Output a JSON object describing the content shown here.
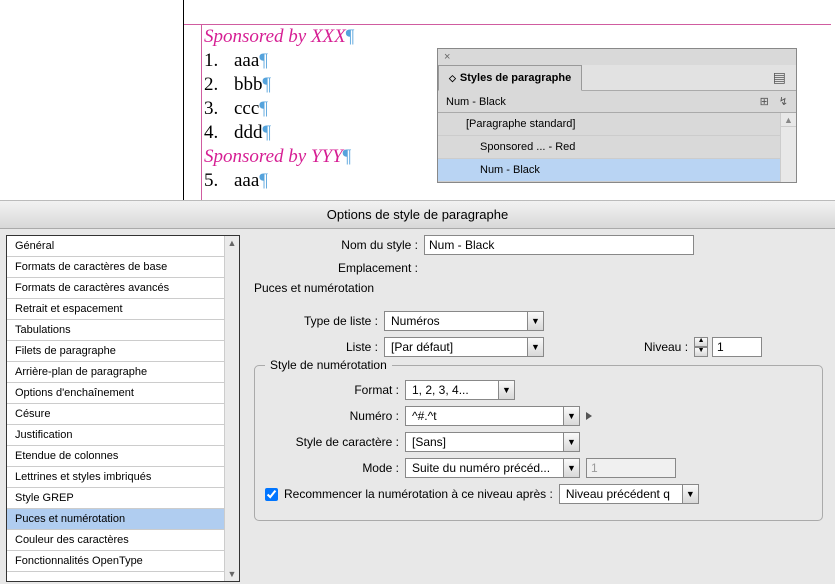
{
  "document": {
    "sponsored_x": "Sponsored by XXX",
    "sponsored_y": "Sponsored by YYY",
    "pilcrow": "¶",
    "items": [
      {
        "n": "1.",
        "t": "aaa"
      },
      {
        "n": "2.",
        "t": "bbb"
      },
      {
        "n": "3.",
        "t": "ccc"
      },
      {
        "n": "4.",
        "t": "ddd"
      }
    ],
    "items2": [
      {
        "n": "5.",
        "t": "aaa"
      }
    ]
  },
  "panel": {
    "title": "Styles de paragraphe",
    "current": "Num - Black",
    "items": [
      {
        "label": "[Paragraphe standard]"
      },
      {
        "label": "Sponsored ... - Red"
      },
      {
        "label": "Num - Black"
      }
    ],
    "close": "×",
    "menu_icon": "≡",
    "new_icon": "⊞",
    "flash_icon": "↯"
  },
  "dialog": {
    "title": "Options de style de paragraphe",
    "sidebar": [
      "Général",
      "Formats de caractères de base",
      "Formats de caractères avancés",
      "Retrait et espacement",
      "Tabulations",
      "Filets de paragraphe",
      "Arrière-plan de paragraphe",
      "Options d'enchaînement",
      "Césure",
      "Justification",
      "Etendue de colonnes",
      "Lettrines et styles imbriqués",
      "Style GREP",
      "Puces et numérotation",
      "Couleur des caractères",
      "Fonctionnalités OpenType"
    ],
    "selected_sidebar_index": 13,
    "labels": {
      "nom": "Nom du style :",
      "emplacement": "Emplacement :",
      "section": "Puces et numérotation",
      "type_liste": "Type de liste :",
      "liste": "Liste :",
      "niveau": "Niveau :",
      "fieldset": "Style de numérotation",
      "format": "Format :",
      "numero": "Numéro :",
      "style_car": "Style de caractère :",
      "mode": "Mode :",
      "recommencer": "Recommencer la numérotation à ce niveau après :"
    },
    "values": {
      "nom": "Num - Black",
      "type_liste": "Numéros",
      "liste": "[Par défaut]",
      "niveau": "1",
      "format": "1, 2, 3, 4...",
      "numero": "^#.^t",
      "style_car": "[Sans]",
      "mode": "Suite du numéro précéd...",
      "mode_num": "1",
      "recommencer_val": "Niveau précédent q"
    }
  }
}
